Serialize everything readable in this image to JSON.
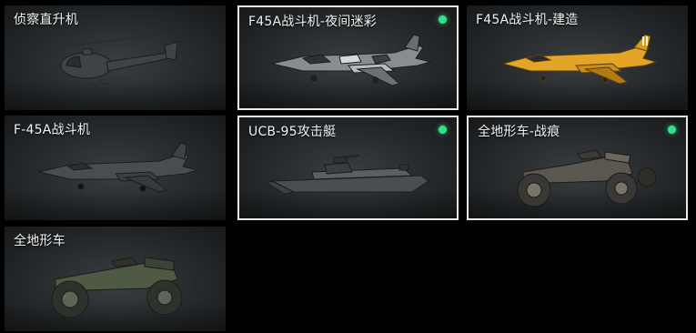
{
  "vehicles": [
    {
      "label": "侦察直升机",
      "selected": false,
      "owned": false,
      "icon": "helicopter-icon"
    },
    {
      "label": "F45A战斗机-夜间迷彩",
      "selected": true,
      "owned": true,
      "icon": "fighter-jet-icon"
    },
    {
      "label": "F45A战斗机-建造",
      "selected": false,
      "owned": false,
      "icon": "fighter-jet-icon"
    },
    {
      "label": "F-45A战斗机",
      "selected": false,
      "owned": false,
      "icon": "fighter-jet-icon"
    },
    {
      "label": "UCB-95攻击艇",
      "selected": true,
      "owned": true,
      "icon": "attack-boat-icon"
    },
    {
      "label": "全地形车-战痕",
      "selected": true,
      "owned": true,
      "icon": "atv-icon"
    },
    {
      "label": "全地形车",
      "selected": false,
      "owned": false,
      "icon": "atv-icon"
    }
  ],
  "colors": {
    "background": "#000000",
    "card": "#25292b",
    "selected_border": "#e9e9e9",
    "owned_dot": "#33e08a",
    "jet_night_camo": "#8a8d90",
    "jet_build": "#e3a527",
    "jet_default": "#4a4d50",
    "boat": "#4b4e51",
    "atv_battle": "#5a5650",
    "atv_green": "#4f5a45"
  }
}
